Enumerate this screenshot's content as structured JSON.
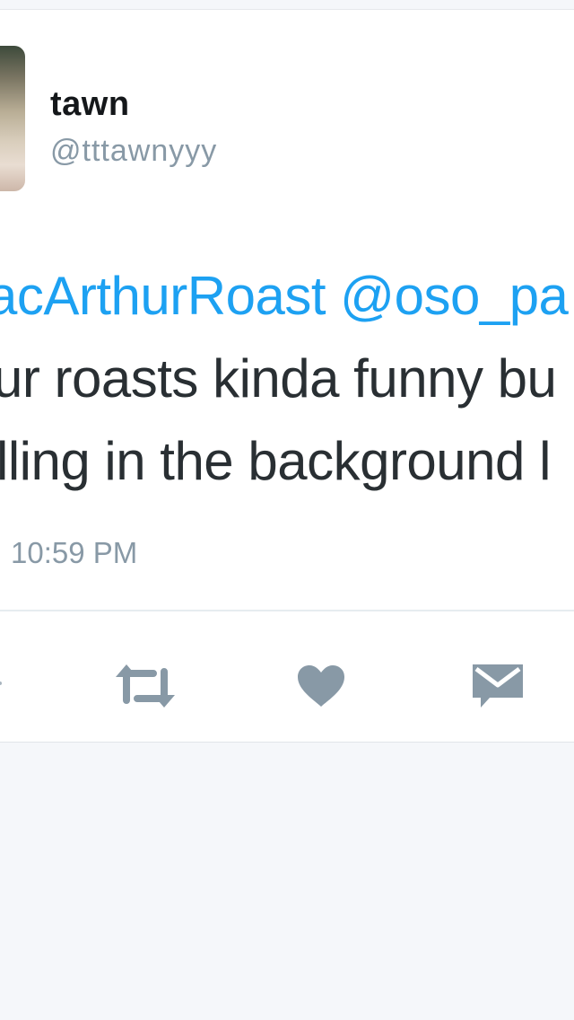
{
  "tweet": {
    "author": {
      "display_name": "tawn",
      "handle": "@tttawnyyy"
    },
    "body_lines": [
      {
        "mention_1": "acArthurRoast",
        "mention_2": "@oso_pa"
      },
      {
        "text": "ur roasts kinda funny bu"
      },
      {
        "text": "lling in the background l"
      }
    ],
    "timestamp": "10:59 PM"
  },
  "actions": {
    "icons": [
      "reply-icon",
      "retweet-icon",
      "like-icon",
      "message-icon"
    ]
  },
  "colors": {
    "link": "#1da1f2",
    "text": "#292f33",
    "muted": "#8899a6",
    "icon": "#8899a6",
    "background": "#f5f7fa"
  }
}
